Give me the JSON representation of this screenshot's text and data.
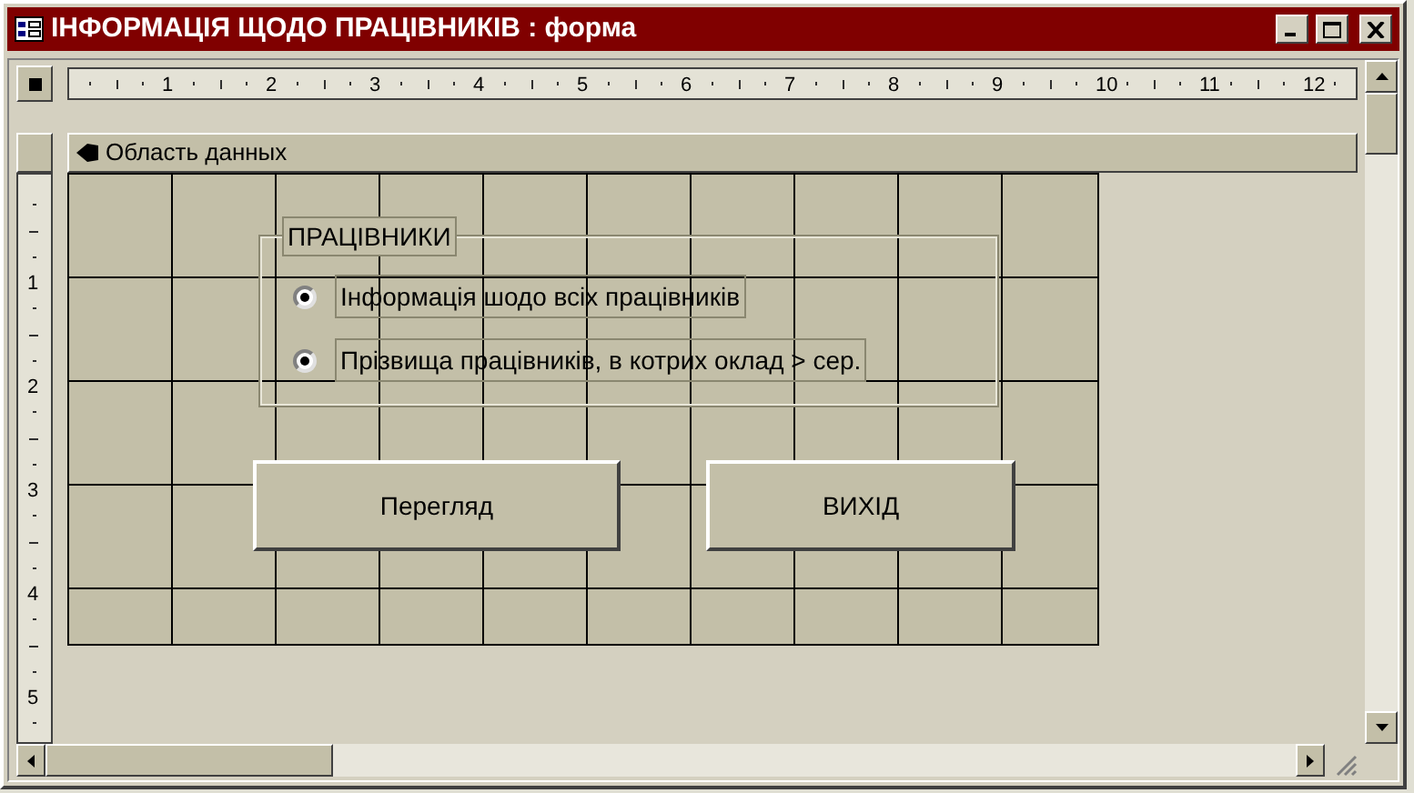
{
  "window": {
    "title": "ІНФОРМАЦІЯ ЩОДО ПРАЦІВНИКІВ : форма"
  },
  "ruler": {
    "horizontal": [
      "1",
      "2",
      "3",
      "4",
      "5",
      "6",
      "7",
      "8",
      "9",
      "10",
      "11",
      "12"
    ],
    "vertical": [
      "1",
      "2",
      "3",
      "4",
      "5"
    ]
  },
  "section": {
    "label": "Область данных"
  },
  "option_group": {
    "label": "ПРАЦІВНИКИ",
    "options": [
      {
        "label": "Інформація шодо всіх працівників",
        "selected": true
      },
      {
        "label": "Прізвища працівників, в котрих оклад > сер.",
        "selected": true
      }
    ]
  },
  "buttons": [
    "Перегляд",
    "ВИХІД"
  ]
}
